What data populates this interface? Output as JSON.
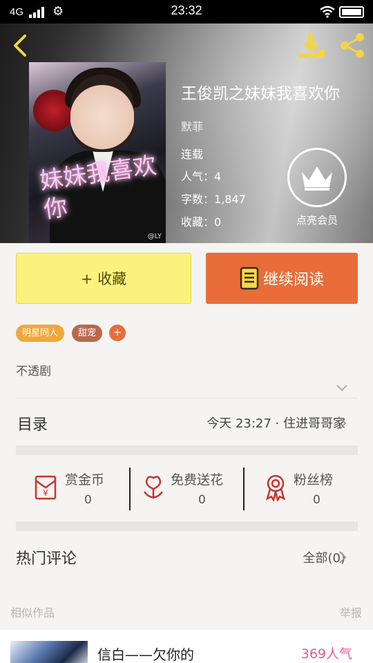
{
  "status_bar": {
    "network": "4G",
    "time": "23:32"
  },
  "book": {
    "title": "王俊凯之妹妹我喜欢你",
    "author": "默菲",
    "status": "连载",
    "popularity": "人气：4",
    "word_count": "字数：1,847",
    "favorites": "收藏：0",
    "cover_text": "妹妹我喜欢你",
    "cover_signature": "@LY"
  },
  "vip": {
    "label": "点亮会员"
  },
  "actions": {
    "collect_label": "+ 收藏",
    "read_label": "继续阅读"
  },
  "tags": [
    {
      "label": "明星同人",
      "color": "#f0a83a"
    },
    {
      "label": "甜宠",
      "color": "#b8684e"
    }
  ],
  "tag_add_label": "+",
  "summary": "不透剧",
  "toc": {
    "label": "目录",
    "latest": "今天 23:27 · 住进哥哥家"
  },
  "stats": [
    {
      "icon": "red-envelope-icon",
      "label": "赏金币",
      "value": "0"
    },
    {
      "icon": "flower-icon",
      "label": "免费送花",
      "value": "0"
    },
    {
      "icon": "medal-icon",
      "label": "粉丝榜",
      "value": "0"
    }
  ],
  "hot_comments": {
    "label": "热门评论",
    "all_label": "全部(0)"
  },
  "similar": {
    "label": "相似作品",
    "report_label": "举报",
    "items": [
      {
        "title": "信白——欠你的",
        "popularity": "369人气"
      }
    ]
  },
  "colors": {
    "accent_orange": "#e96d38",
    "collect_yellow": "#fbf27d",
    "icon_gold": "#f2d34b",
    "icon_red": "#c8332b",
    "popularity_pink": "#e55a9a"
  }
}
